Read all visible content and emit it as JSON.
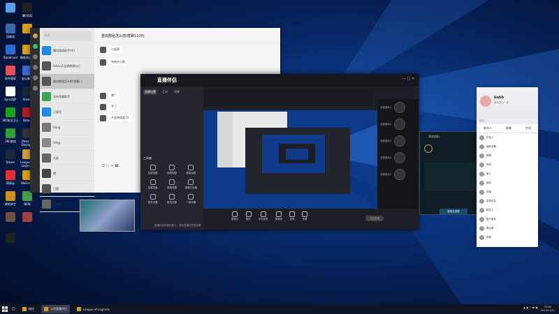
{
  "desktop_icons": [
    {
      "label": "",
      "color": "#5aa0e8"
    },
    {
      "label": "腾讯QQ",
      "color": "#222"
    },
    {
      "label": "回收站",
      "color": "#3a6aa8"
    },
    {
      "label": "",
      "color": "#d9a020"
    },
    {
      "label": "Bandicam",
      "color": "#2a6ad0"
    },
    {
      "label": "微软浏览器",
      "color": "#d9a020"
    },
    {
      "label": "软件管家",
      "color": "#e55050"
    },
    {
      "label": "金山毒霸",
      "color": "#3a6ad0"
    },
    {
      "label": "Sync同步",
      "color": "#ffffff"
    },
    {
      "label": "Steam",
      "color": "#1b2838"
    },
    {
      "label": "360安全卫士",
      "color": "#1aa31a"
    },
    {
      "label": "Dota2",
      "color": "#b02020"
    },
    {
      "label": "360游戏",
      "color": "#30a030"
    },
    {
      "label": "Dead by Daylight",
      "color": "#333"
    },
    {
      "label": "Steam",
      "color": "#1b2838"
    },
    {
      "label": "League of Legends",
      "color": "#c8a040"
    },
    {
      "label": "网易云",
      "color": "#e03030"
    },
    {
      "label": "WeGame",
      "color": "#d9a020"
    },
    {
      "label": "绝地求生",
      "color": "#d09020"
    },
    {
      "label": "NEW",
      "color": "#44a044"
    },
    {
      "label": "",
      "color": "#6a5040"
    },
    {
      "label": "",
      "color": "#a04040"
    },
    {
      "label": "",
      "color": "#222"
    }
  ],
  "wechat": {
    "search_placeholder": "搜索",
    "chat_title": "重启群组怎么样(群聊1100)",
    "contacts": [
      {
        "name": "腾讯游戏助手(中)",
        "color": "#1e88e5"
      },
      {
        "name": "Salary1全部群组(计)",
        "color": "#555"
      },
      {
        "name": "重启群组怎么样(群聊..)",
        "color": "#555"
      },
      {
        "name": "文件传输助手",
        "color": "#3aa55a"
      },
      {
        "name": "订阅号",
        "color": "#1e88e5"
      },
      {
        "name": "Sang",
        "color": "#777"
      },
      {
        "name": "Yifng",
        "color": "#888"
      },
      {
        "name": "凡辰",
        "color": "#666"
      },
      {
        "name": "雪",
        "color": "#444"
      },
      {
        "name": "门窗",
        "color": "#555"
      },
      {
        "name": "西游西",
        "color": "#666"
      }
    ],
    "messages": [
      "二姐哥",
      "哈哈开心吧",
      "嗯?",
      "写了",
      "不会带速度73"
    ]
  },
  "live_app": {
    "logo": "直播伴侣",
    "tabs": [
      "直播设置",
      "互动",
      "直播"
    ],
    "section": "工具箱",
    "tools": [
      "加载设置",
      "录屏设置",
      "弹幕设置",
      "加载场景",
      "语音设置",
      "摄像头设置",
      "更多设置",
      "推流设置",
      "一般设置"
    ],
    "bottom_tools": [
      "摄像头",
      "图片",
      "手机投屏",
      "多媒体",
      "游戏",
      "全屏"
    ],
    "start_label": "开始直播",
    "viewers": [
      "当前观众1",
      "当前观众2",
      "当前观众3",
      "当前观众4",
      "当前观众5"
    ],
    "notice": "直播伴侣的操作提示，请在直播前完成设置"
  },
  "game_popup": {
    "title": "游戏资料",
    "button": "游戏交流群"
  },
  "qq": {
    "name": "babb",
    "signature": "每天开心一点",
    "search": "搜索",
    "tabs": [
      "联系人",
      "群聊",
      "空间"
    ],
    "contacts": [
      "好友1",
      "我的设备",
      "群聊",
      "同学",
      "家人",
      "朋友",
      "同事",
      "游戏好友",
      "陌生人",
      "客户服务",
      "黑名单",
      "其他"
    ]
  },
  "taskbar": {
    "apps": [
      {
        "label": "微信",
        "active": false
      },
      {
        "label": "斗鱼直播伴侣",
        "active": true
      },
      {
        "label": "League of Legends",
        "active": false
      }
    ],
    "clock_time": "23:09",
    "clock_date": "2019/11/11"
  }
}
